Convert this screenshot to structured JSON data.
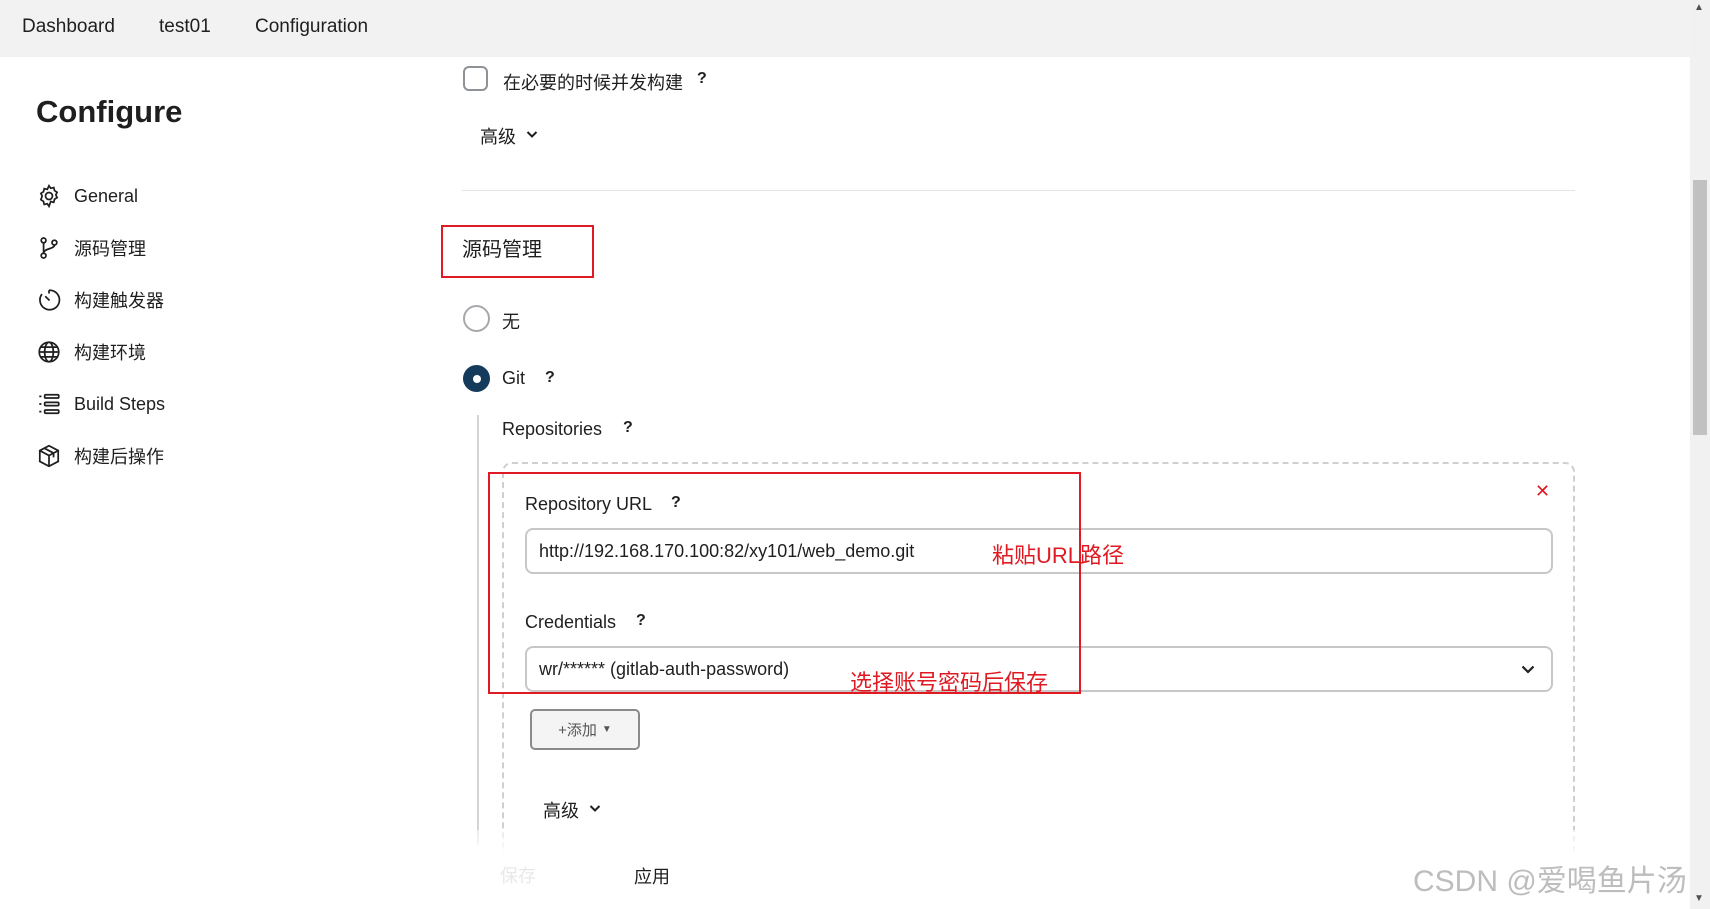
{
  "breadcrumb": [
    "Dashboard",
    "test01",
    "Configuration"
  ],
  "page_title": "Configure",
  "sidebar": {
    "items": [
      {
        "label": "General",
        "icon": "gear-icon"
      },
      {
        "label": "源码管理",
        "icon": "branch-icon"
      },
      {
        "label": "构建触发器",
        "icon": "clock-icon"
      },
      {
        "label": "构建环境",
        "icon": "globe-icon"
      },
      {
        "label": "Build Steps",
        "icon": "list-icon"
      },
      {
        "label": "构建后操作",
        "icon": "box-icon"
      }
    ]
  },
  "general": {
    "concurrent_label": "在必要的时候并发构建",
    "concurrent_checked": false,
    "advanced_label": "高级"
  },
  "scm": {
    "section_title": "源码管理",
    "options": [
      {
        "label": "无",
        "selected": false
      },
      {
        "label": "Git",
        "selected": true
      }
    ],
    "repositories_label": "Repositories",
    "repository_url_label": "Repository URL",
    "repository_url_value": "http://192.168.170.100:82/xy101/web_demo.git",
    "credentials_label": "Credentials",
    "credentials_value": "wr/****** (gitlab-auth-password)",
    "add_button": "+添加",
    "advanced_label": "高级"
  },
  "help_mark": "?",
  "annotations": {
    "url_note": "粘贴URL路径",
    "credentials_note": "选择账号密码后保存"
  },
  "footer": {
    "save_label": "保存",
    "apply_label": "应用"
  },
  "watermark": "CSDN @爱喝鱼片汤",
  "colors": {
    "accent": "#153b5c",
    "annotation_red": "#e01a22",
    "topbar_bg": "#f2f2f3"
  }
}
